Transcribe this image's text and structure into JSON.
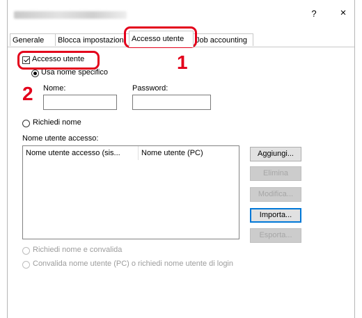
{
  "window": {
    "title_obscured": true,
    "help_label": "?",
    "close_label": "×"
  },
  "tabs": [
    {
      "label": "Generale",
      "active": false
    },
    {
      "label": "Blocca impostazioni",
      "active": false
    },
    {
      "label": "Accesso utente",
      "active": true
    },
    {
      "label": "Job accounting",
      "active": false
    }
  ],
  "user_access": {
    "checkbox_label": "Accesso utente",
    "checked": true,
    "specific_name_label": "Usa nome specifico",
    "name_label": "Nome:",
    "name_value": "",
    "password_label": "Password:",
    "password_value": "",
    "request_name_label": "Richiedi nome",
    "login_list_label": "Nome utente accesso:",
    "columns": [
      "Nome utente accesso (sis...",
      "Nome utente (PC)"
    ],
    "rows": []
  },
  "buttons": {
    "add": "Aggiungi...",
    "delete": "Elimina",
    "modify": "Modifica...",
    "import": "Importa...",
    "export": "Esporta..."
  },
  "options": {
    "request_validate": "Richiedi nome e convalida",
    "validate_pc": "Convalida nome utente (PC) o richiedi nome utente di login"
  },
  "callouts": {
    "step1": "1",
    "step2": "2",
    "color": "#e3001b"
  }
}
